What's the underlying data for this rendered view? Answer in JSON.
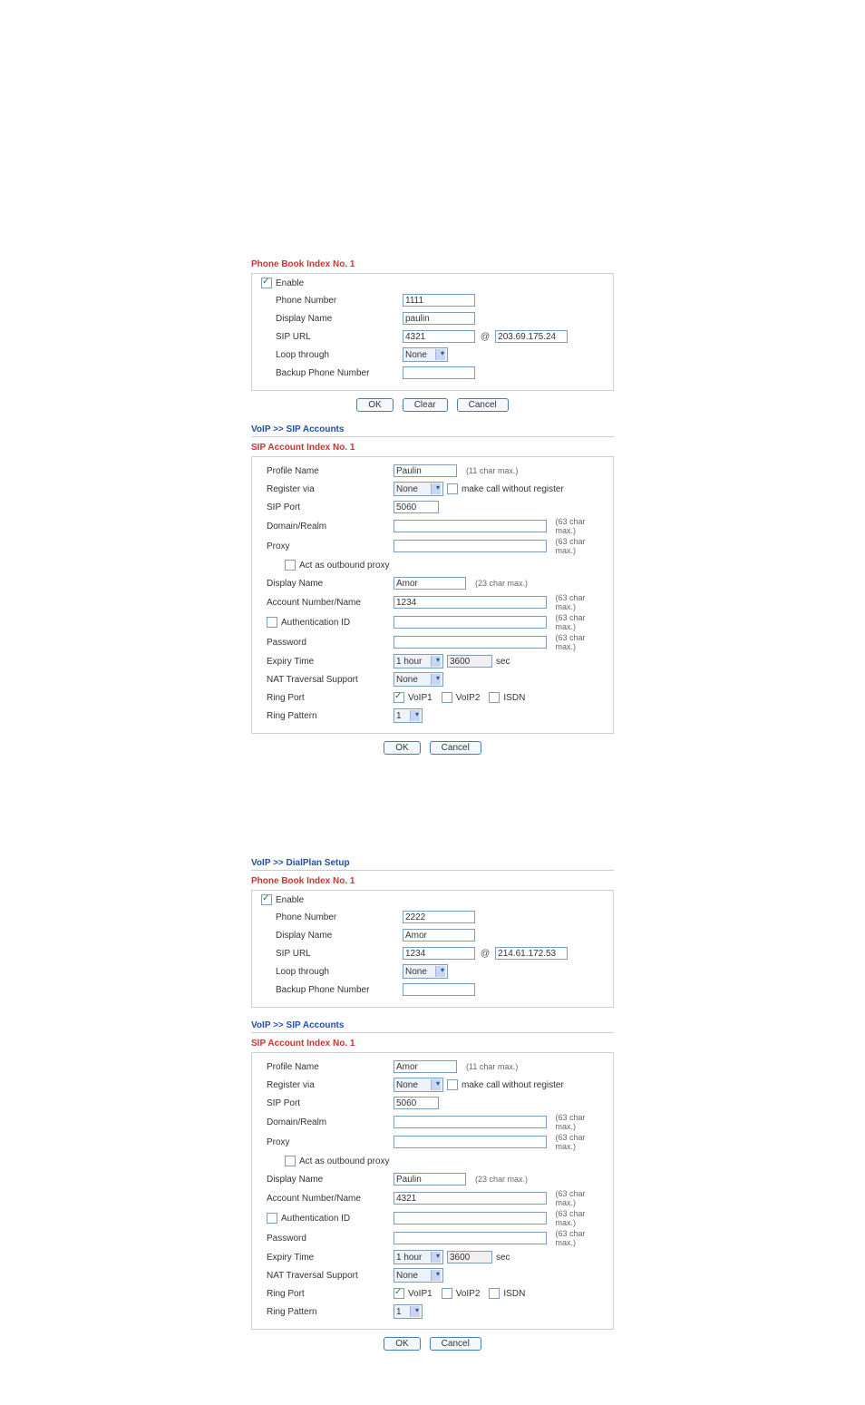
{
  "section1": {
    "phonebook": {
      "title": "Phone Book Index No. 1",
      "enable_label": "Enable",
      "phone_number": {
        "label": "Phone Number",
        "value": "1111"
      },
      "display_name": {
        "label": "Display Name",
        "value": "paulin"
      },
      "sip_url": {
        "label": "SIP URL",
        "user": "4321",
        "host": "203.69.175.24"
      },
      "loop_through": {
        "label": "Loop through",
        "value": "None"
      },
      "backup_phone": {
        "label": "Backup Phone Number",
        "value": ""
      },
      "buttons": {
        "ok": "OK",
        "clear": "Clear",
        "cancel": "Cancel"
      }
    },
    "sip_breadcrumb": "VoIP >> SIP Accounts",
    "sip": {
      "title": "SIP Account Index No. 1",
      "profile_name": {
        "label": "Profile Name",
        "value": "Paulin",
        "hint": "(11 char max.)"
      },
      "register_via": {
        "label": "Register via",
        "value": "None",
        "checkbox_label": "make call without register"
      },
      "sip_port": {
        "label": "SIP Port",
        "value": "5060"
      },
      "domain_realm": {
        "label": "Domain/Realm",
        "value": "",
        "hint": "(63 char max.)"
      },
      "proxy": {
        "label": "Proxy",
        "value": "",
        "hint": "(63 char max.)"
      },
      "act_outbound": {
        "label": "Act as outbound proxy"
      },
      "display_name": {
        "label": "Display Name",
        "value": "Amor",
        "hint": "(23 char max.)"
      },
      "account_number": {
        "label": "Account Number/Name",
        "value": "1234",
        "hint": "(63 char max.)"
      },
      "auth_id": {
        "label": "Authentication ID",
        "value": "",
        "hint": "(63 char max.)"
      },
      "password": {
        "label": "Password",
        "value": "",
        "hint": "(63 char max.)"
      },
      "expiry": {
        "label": "Expiry Time",
        "sel": "1 hour",
        "sec_value": "3600",
        "sec_label": "sec"
      },
      "nat": {
        "label": "NAT Traversal Support",
        "value": "None"
      },
      "ring_port": {
        "label": "Ring Port",
        "voip1": "VoIP1",
        "voip2": "VoIP2",
        "isdn": "ISDN"
      },
      "ring_pattern": {
        "label": "Ring Pattern",
        "value": "1"
      },
      "buttons": {
        "ok": "OK",
        "cancel": "Cancel"
      }
    }
  },
  "section2": {
    "dialplan_breadcrumb": "VoIP >> DialPlan Setup",
    "phonebook": {
      "title": "Phone Book Index No. 1",
      "enable_label": "Enable",
      "phone_number": {
        "label": "Phone Number",
        "value": "2222"
      },
      "display_name": {
        "label": "Display Name",
        "value": "Amor"
      },
      "sip_url": {
        "label": "SIP URL",
        "user": "1234",
        "host": "214.61.172.53"
      },
      "loop_through": {
        "label": "Loop through",
        "value": "None"
      },
      "backup_phone": {
        "label": "Backup Phone Number",
        "value": ""
      }
    },
    "sip_breadcrumb": "VoIP >> SIP Accounts",
    "sip": {
      "title": "SIP Account Index No. 1",
      "profile_name": {
        "label": "Profile Name",
        "value": "Amor",
        "hint": "(11 char max.)"
      },
      "register_via": {
        "label": "Register via",
        "value": "None",
        "checkbox_label": "make call without register"
      },
      "sip_port": {
        "label": "SIP Port",
        "value": "5060"
      },
      "domain_realm": {
        "label": "Domain/Realm",
        "value": "",
        "hint": "(63 char max.)"
      },
      "proxy": {
        "label": "Proxy",
        "value": "",
        "hint": "(63 char max.)"
      },
      "act_outbound": {
        "label": "Act as outbound proxy"
      },
      "display_name": {
        "label": "Display Name",
        "value": "Paulin",
        "hint": "(23 char max.)"
      },
      "account_number": {
        "label": "Account Number/Name",
        "value": "4321",
        "hint": "(63 char max.)"
      },
      "auth_id": {
        "label": "Authentication ID",
        "value": "",
        "hint": "(63 char max.)"
      },
      "password": {
        "label": "Password",
        "value": "",
        "hint": "(63 char max.)"
      },
      "expiry": {
        "label": "Expiry Time",
        "sel": "1 hour",
        "sec_value": "3600",
        "sec_label": "sec"
      },
      "nat": {
        "label": "NAT Traversal Support",
        "value": "None"
      },
      "ring_port": {
        "label": "Ring Port",
        "voip1": "VoIP1",
        "voip2": "VoIP2",
        "isdn": "ISDN"
      },
      "ring_pattern": {
        "label": "Ring Pattern",
        "value": "1"
      },
      "buttons": {
        "ok": "OK",
        "cancel": "Cancel"
      }
    }
  }
}
